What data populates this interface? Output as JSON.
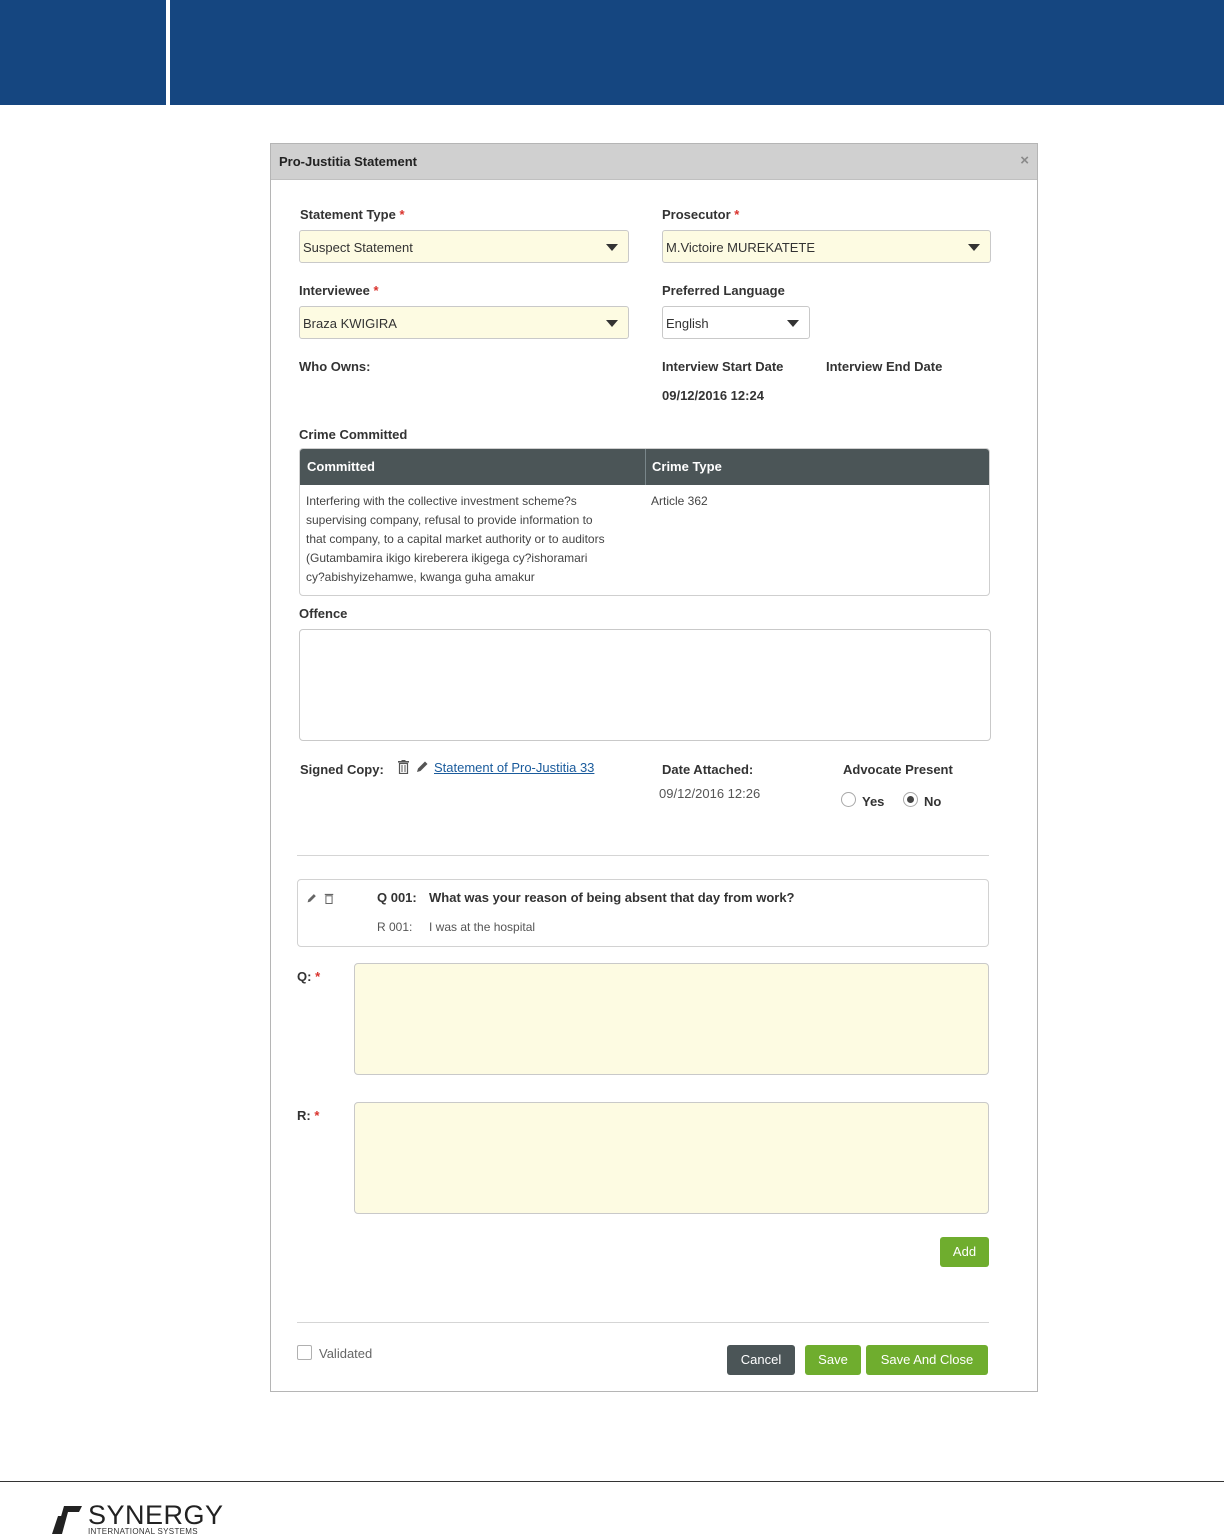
{
  "dialog": {
    "title": "Pro-Justitia Statement",
    "close_icon": "×"
  },
  "form": {
    "statement_type": {
      "label": "Statement Type",
      "required": "*",
      "value": "Suspect Statement"
    },
    "prosecutor": {
      "label": "Prosecutor",
      "required": "*",
      "value": "M.Victoire MUREKATETE"
    },
    "interviewee": {
      "label": "Interviewee",
      "required": "*",
      "value": "Braza KWIGIRA"
    },
    "preferred_language": {
      "label": "Preferred Language",
      "value": "English"
    },
    "who_owns": {
      "label": "Who Owns:"
    },
    "interview_start": {
      "label": "Interview Start Date",
      "value": "09/12/2016 12:24"
    },
    "interview_end": {
      "label": "Interview End Date"
    },
    "crime_committed": {
      "label": "Crime Committed",
      "columns": [
        "Committed",
        "Crime Type"
      ],
      "rows": [
        {
          "committed_lines": [
            "Interfering with the collective investment scheme?s",
            "supervising company, refusal to provide information to",
            "that company, to a capital market authority or to auditors",
            "(Gutambamira ikigo kireberera ikigega cy?ishoramari",
            "cy?abishyizehamwe, kwanga guha amakur"
          ],
          "crime_type": "Article 362"
        }
      ]
    },
    "offence": {
      "label": "Offence",
      "value": ""
    },
    "signed_copy": {
      "label": "Signed Copy:",
      "link": "Statement of Pro-Justitia 33"
    },
    "date_attached": {
      "label": "Date Attached:",
      "value": "09/12/2016 12:26"
    },
    "advocate_present": {
      "label": "Advocate Present",
      "options": [
        "Yes",
        "No"
      ],
      "selected": "No"
    }
  },
  "qa": {
    "items": [
      {
        "q_label": "Q 001:",
        "question": "What was your reason of being absent that day from work?",
        "r_label": "R 001:",
        "response": "I was at the hospital"
      }
    ],
    "q_field_label": "Q:",
    "r_field_label": "R:",
    "required": "*",
    "add_label": "Add"
  },
  "footer": {
    "validated_label": "Validated",
    "cancel_label": "Cancel",
    "save_label": "Save",
    "save_close_label": "Save And Close"
  },
  "brand": {
    "name": "SYNERGY",
    "tagline": "INTERNATIONAL SYSTEMS"
  },
  "colors": {
    "banner": "#154680",
    "accent_green": "#6fad2e",
    "grid_header": "#4b5557",
    "required_field_bg": "#fdfbe2"
  }
}
